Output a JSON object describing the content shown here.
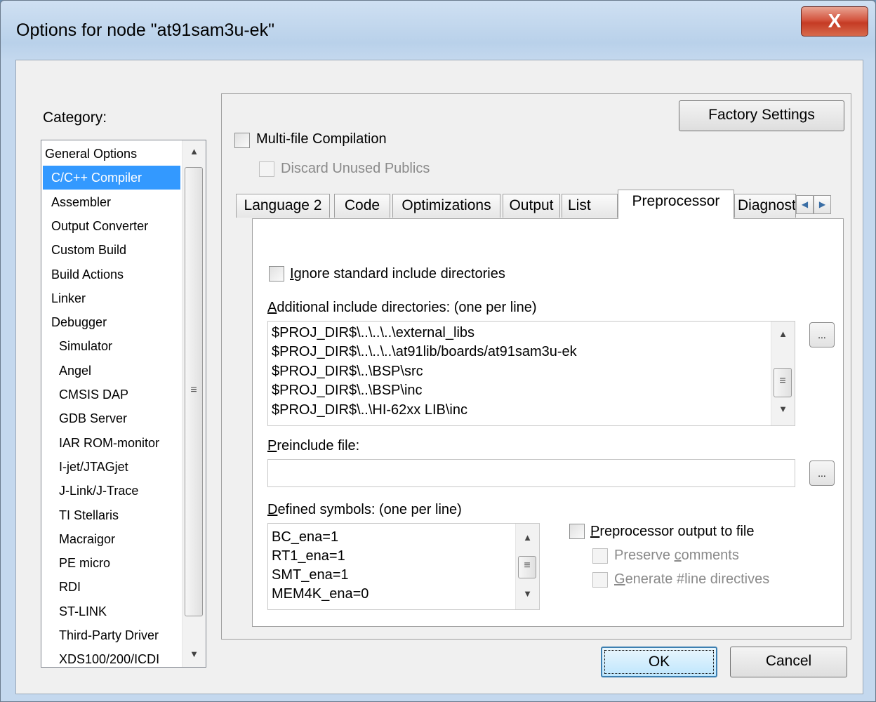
{
  "window": {
    "title": "Options for node \"at91sam3u-ek\"",
    "close_label": "X"
  },
  "category": {
    "label": "Category:",
    "items": [
      {
        "label": "General Options",
        "selected": false
      },
      {
        "label": "C/C++ Compiler",
        "selected": true
      },
      {
        "label": "Assembler",
        "selected": false
      },
      {
        "label": "Output Converter",
        "selected": false
      },
      {
        "label": "Custom Build",
        "selected": false
      },
      {
        "label": "Build Actions",
        "selected": false
      },
      {
        "label": "Linker",
        "selected": false
      },
      {
        "label": "Debugger",
        "selected": false
      },
      {
        "label": "Simulator",
        "selected": false
      },
      {
        "label": "Angel",
        "selected": false
      },
      {
        "label": "CMSIS DAP",
        "selected": false
      },
      {
        "label": "GDB Server",
        "selected": false
      },
      {
        "label": "IAR ROM-monitor",
        "selected": false
      },
      {
        "label": "I-jet/JTAGjet",
        "selected": false
      },
      {
        "label": "J-Link/J-Trace",
        "selected": false
      },
      {
        "label": "TI Stellaris",
        "selected": false
      },
      {
        "label": "Macraigor",
        "selected": false
      },
      {
        "label": "PE micro",
        "selected": false
      },
      {
        "label": "RDI",
        "selected": false
      },
      {
        "label": "ST-LINK",
        "selected": false
      },
      {
        "label": "Third-Party Driver",
        "selected": false
      },
      {
        "label": "XDS100/200/ICDI",
        "selected": false
      }
    ]
  },
  "factory_settings_label": "Factory Settings",
  "multifile": {
    "label": "Multi-file Compilation",
    "checked": false
  },
  "discard_unused": {
    "label": "Discard Unused Publics",
    "checked": false,
    "enabled": false
  },
  "tabs": [
    {
      "label": "Language 2",
      "active": false
    },
    {
      "label": "Code",
      "active": false
    },
    {
      "label": "Optimizations",
      "active": false
    },
    {
      "label": "Output",
      "active": false
    },
    {
      "label": "List",
      "active": false
    },
    {
      "label": "Preprocessor",
      "active": true
    },
    {
      "label": "Diagnostics",
      "active": false
    }
  ],
  "preprocessor": {
    "ignore_std_include": {
      "label_first": "I",
      "label_rest": "gnore standard include directories",
      "checked": false
    },
    "include_dirs": {
      "label_first": "A",
      "label_rest": "dditional include directories: (one per line)",
      "lines": [
        "$PROJ_DIR$\\..\\..\\..\\external_libs",
        "$PROJ_DIR$\\..\\..\\..\\at91lib/boards/at91sam3u-ek",
        "$PROJ_DIR$\\..\\BSP\\src",
        "$PROJ_DIR$\\..\\BSP\\inc",
        "$PROJ_DIR$\\..\\HI-62xx LIB\\inc"
      ]
    },
    "preinclude": {
      "label_first": "P",
      "label_rest": "reinclude file:",
      "value": ""
    },
    "defined_symbols": {
      "label_first": "D",
      "label_rest": "efined symbols: (one per line)",
      "lines": [
        "BC_ena=1",
        "RT1_ena=1",
        "SMT_ena=1",
        "MEM4K_ena=0"
      ]
    },
    "output_to_file": {
      "label_first": "P",
      "label_rest": "reprocessor output to file",
      "checked": false
    },
    "preserve_comments": {
      "label_pre": "Preserve ",
      "label_underline": "c",
      "label_post": "omments",
      "checked": false,
      "enabled": false
    },
    "line_directives": {
      "label_underline": "G",
      "label_post": "enerate #line directives",
      "checked": false,
      "enabled": false
    },
    "browse_label": "..."
  },
  "buttons": {
    "ok": "OK",
    "cancel": "Cancel"
  }
}
